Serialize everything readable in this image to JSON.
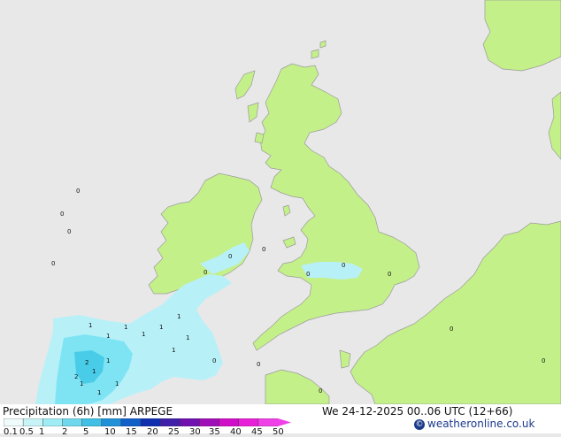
{
  "map": {
    "colors": {
      "sea": "#e8e8e8",
      "land": "#c4f08a",
      "coast": "#9a9a9a",
      "precip_light": "#b8f0f8",
      "precip_mid": "#7ee4f4",
      "precip_heavy": "#48cce8"
    },
    "precip_markers": [
      "0",
      "0",
      "0",
      "0",
      "0",
      "0",
      "0",
      "0",
      "0",
      "0",
      "0",
      "1",
      "1",
      "1",
      "1",
      "1",
      "1",
      "1",
      "1",
      "1",
      "1",
      "1",
      "1",
      "1",
      "2",
      "2",
      "0",
      "0",
      "0",
      "0"
    ]
  },
  "footer": {
    "title": "Precipitation (6h) [mm] ARPEGE",
    "validity": "We 24-12-2025 00..06 UTC (12+66)",
    "credit": "weatheronline.co.uk",
    "legend": {
      "ticks": [
        "0.1",
        "0.5",
        "1",
        "2",
        "5",
        "10",
        "15",
        "20",
        "25",
        "30",
        "35",
        "40",
        "45",
        "50"
      ],
      "colors": [
        "#f0fcfc",
        "#c8f4f8",
        "#a0ecf4",
        "#70d8ec",
        "#40c0e4",
        "#2090d8",
        "#1060c8",
        "#1030b0",
        "#4020a8",
        "#7010b0",
        "#a010b8",
        "#d010c8",
        "#e820d8",
        "#f040e8"
      ]
    }
  }
}
